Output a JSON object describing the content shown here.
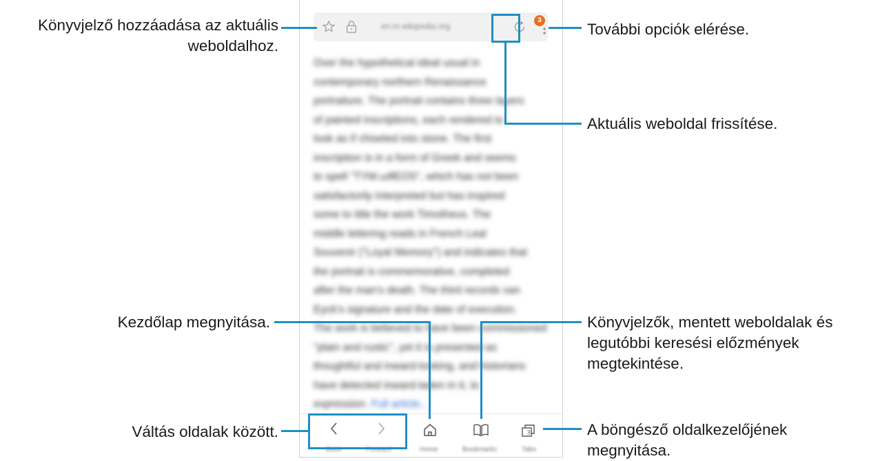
{
  "callouts": {
    "bookmark_add": "Könyvjelző hozzáadása az aktuális weboldalhoz.",
    "more_options": "További opciók elérése.",
    "refresh": "Aktuális weboldal frissítése.",
    "home": "Kezdőlap megnyitása.",
    "bookmarks_view": "Könyvjelzők, mentett weboldalak és legutóbbi keresési előzmények megtekintése.",
    "switch_pages": "Váltás oldalak között.",
    "tab_manager": "A böngésző oldalkezelőjének megnyitása."
  },
  "browser": {
    "url": "en.m.wikipedia.org",
    "tab_count_badge": "3",
    "article_lines": [
      "Over the hypothetical ideal usual in",
      "contemporary northern Renaissance",
      "portraiture. The portrait contains three layers",
      "of painted inscriptions, each rendered to",
      "look as if chiseled into stone. The first",
      "inscription is in a form of Greek and seems",
      "to spell \"TYM.ωθEOS\", which has not been",
      "satisfactorily interpreted but has inspired",
      "some to title the work Timotheus. The",
      "middle lettering reads in French Leal",
      "Souvenir (\"Loyal Memory\") and indicates that",
      "the portrait is commemorative, completed",
      "after the man's death. The third records van",
      "Eyck's signature and the date of execution.",
      "The work is believed to have been commissioned",
      "\"plain and rustic\", yet it is presented as",
      "thoughtful and inward-looking, and historians",
      "have detected inward-laden in it, to"
    ],
    "article_last_line": "expression.",
    "article_link": "Full article...",
    "bottom_labels": [
      "Back",
      "Forward",
      "Home",
      "Bookmarks",
      "Tabs"
    ]
  },
  "colors": {
    "accent": "#1e8fc3",
    "badge": "#e8701f",
    "link": "#2c6ed9"
  }
}
